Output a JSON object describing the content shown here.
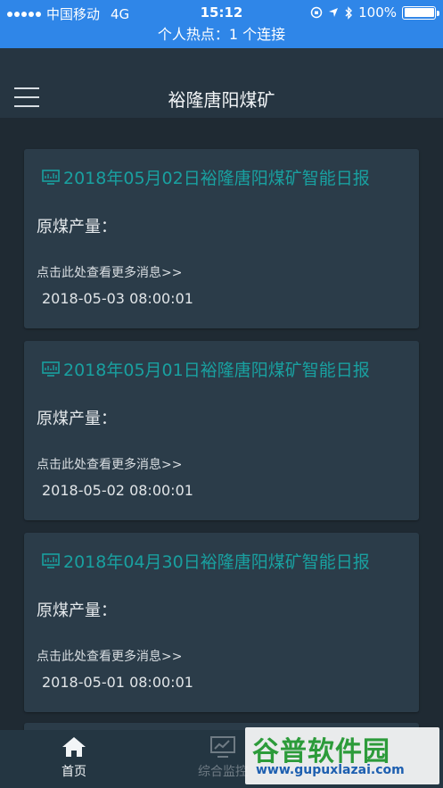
{
  "status_bar": {
    "carrier": "中国移动",
    "network": "4G",
    "time": "15:12",
    "battery": "100%",
    "battery_level": 1.0
  },
  "hotspot_banner": "个人热点：1 个连接",
  "header": {
    "title": "裕隆唐阳煤矿",
    "menu_icon": "hamburger-icon"
  },
  "reports": [
    {
      "title": "2018年05月02日裕隆唐阳煤矿智能日报",
      "label": "原煤产量：",
      "more": "点击此处查看更多消息>>",
      "datetime": "2018-05-03 08:00:01"
    },
    {
      "title": "2018年05月01日裕隆唐阳煤矿智能日报",
      "label": "原煤产量：",
      "more": "点击此处查看更多消息>>",
      "datetime": "2018-05-02 08:00:01"
    },
    {
      "title": "2018年04月30日裕隆唐阳煤矿智能日报",
      "label": "原煤产量：",
      "more": "点击此处查看更多消息>>",
      "datetime": "2018-05-01 08:00:01"
    }
  ],
  "tab_bar": {
    "tabs": [
      {
        "label": "首页",
        "icon": "home-icon",
        "active": true
      },
      {
        "label": "综合监控",
        "icon": "monitor-icon",
        "active": false
      }
    ]
  },
  "watermark": {
    "name": "谷普软件园",
    "url": "www.gupuxlazai.com"
  },
  "colors": {
    "status_bar": "#2f86e8",
    "background": "#1f2a33",
    "card": "#2b3c49",
    "accent": "#19a0a0"
  }
}
